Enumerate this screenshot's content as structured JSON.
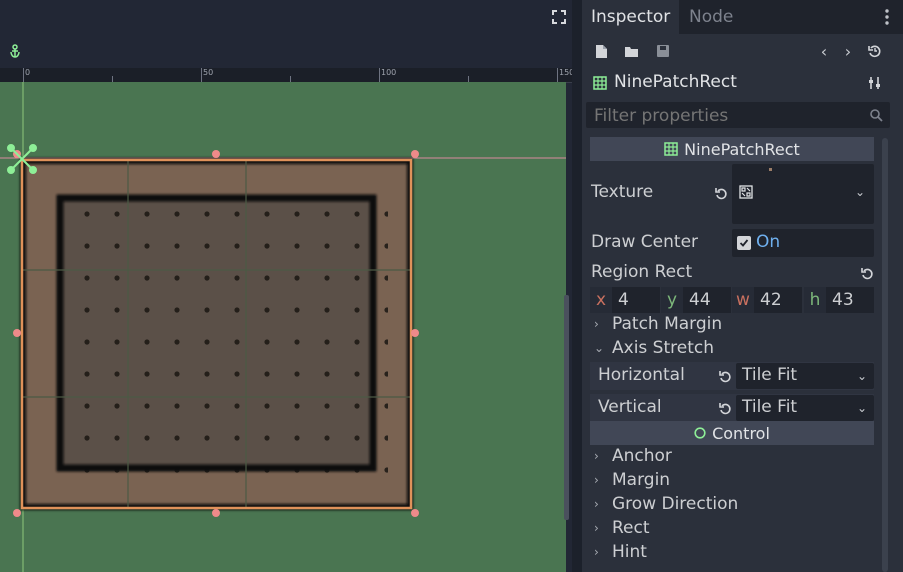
{
  "viewport": {
    "ruler_labels": [
      "0",
      "50",
      "100",
      "150"
    ]
  },
  "inspector": {
    "tabs": [
      {
        "label": "Inspector"
      },
      {
        "label": "Node"
      }
    ],
    "node_name": "NinePatchRect",
    "filter_placeholder": "Filter properties",
    "class_header": "NinePatchRect",
    "properties": {
      "texture_label": "Texture",
      "draw_center_label": "Draw Center",
      "draw_center_value": "On",
      "region_rect_label": "Region Rect",
      "region_rect": {
        "x_key": "x",
        "x": "4",
        "y_key": "y",
        "y": "44",
        "w_key": "w",
        "w": "42",
        "h_key": "h",
        "h": "43"
      },
      "patch_margin_label": "Patch Margin",
      "axis_stretch_label": "Axis Stretch",
      "horizontal_label": "Horizontal",
      "horizontal_value": "Tile Fit",
      "vertical_label": "Vertical",
      "vertical_value": "Tile Fit"
    },
    "control_header": "Control",
    "control_sections": [
      {
        "label": "Anchor"
      },
      {
        "label": "Margin"
      },
      {
        "label": "Grow Direction"
      },
      {
        "label": "Rect"
      },
      {
        "label": "Hint"
      }
    ]
  },
  "colors": {
    "canvas_green": "#4a7551",
    "panel_bg": "#2b303b",
    "accent_blue": "#6fb0ef",
    "selection_orange": "#e0925a",
    "handle_pink": "#ef8a8a",
    "node_icon_green": "#8eef97"
  }
}
